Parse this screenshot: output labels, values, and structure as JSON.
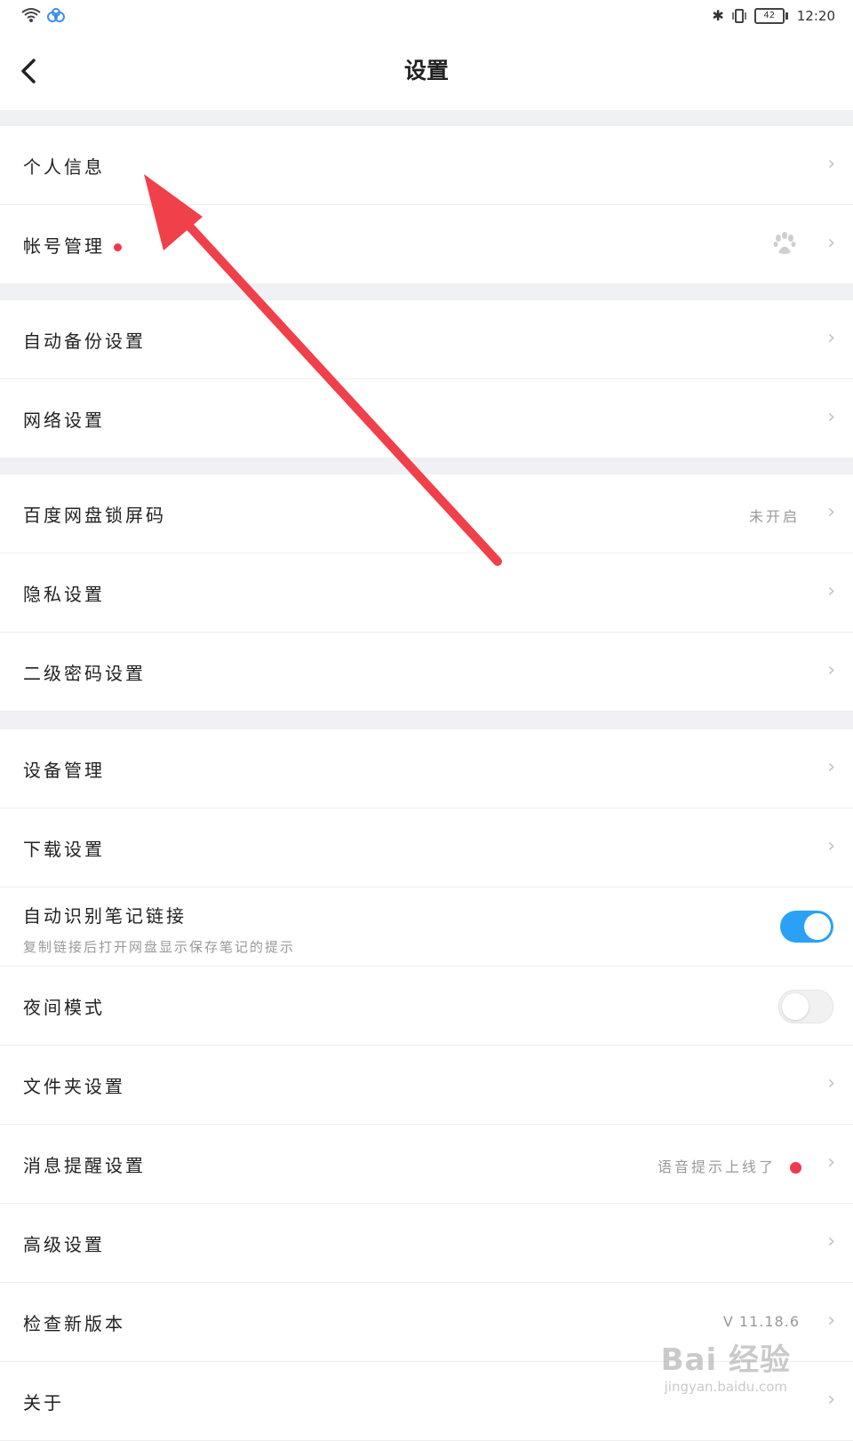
{
  "status_bar": {
    "time": "12:20",
    "battery": "42"
  },
  "header": {
    "title": "设置"
  },
  "rows": {
    "personal_info": "个人信息",
    "account": "帐号管理",
    "auto_backup": "自动备份设置",
    "network": "网络设置",
    "lock_screen": "百度网盘锁屏码",
    "lock_screen_value": "未开启",
    "privacy": "隐私设置",
    "second_password": "二级密码设置",
    "device": "设备管理",
    "download": "下载设置",
    "note_link": "自动识别笔记链接",
    "note_link_desc": "复制链接后打开网盘显示保存笔记的提示",
    "note_link_on": true,
    "night_mode": "夜间模式",
    "night_mode_on": false,
    "folder": "文件夹设置",
    "message": "消息提醒设置",
    "message_value": "语音提示上线了",
    "advanced": "高级设置",
    "check_update": "检查新版本",
    "version": "V 11.18.6",
    "about": "关于"
  },
  "watermark": {
    "logo": "Bai 经验",
    "url": "jingyan.baidu.com"
  },
  "colors": {
    "toggle_on": "#2aa1f5",
    "red_dot": "#f0384f",
    "annotation_arrow": "#f0404a"
  }
}
